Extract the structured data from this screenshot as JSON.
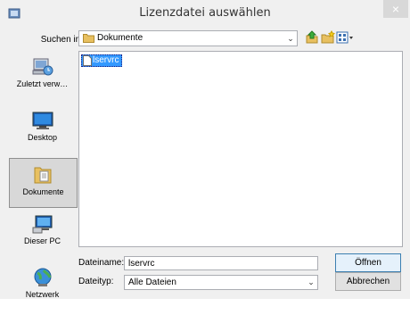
{
  "window": {
    "title": "Lizenzdatei auswählen",
    "close_glyph": "×"
  },
  "lookin": {
    "label": "Suchen in:",
    "value": "Dokumente"
  },
  "places": [
    {
      "label": "Zuletzt verw…",
      "icon": "recent-icon"
    },
    {
      "label": "Desktop",
      "icon": "desktop-icon"
    },
    {
      "label": "Dokumente",
      "icon": "documents-icon",
      "selected": true
    },
    {
      "label": "Dieser PC",
      "icon": "computer-icon"
    },
    {
      "label": "Netzwerk",
      "icon": "network-icon"
    }
  ],
  "files": [
    {
      "name": "lservrc",
      "selected": true
    }
  ],
  "filename": {
    "label": "Dateiname:",
    "value": "lservrc"
  },
  "filetype": {
    "label": "Dateityp:",
    "value": "Alle Dateien"
  },
  "buttons": {
    "open": "Öffnen",
    "cancel": "Abbrechen"
  },
  "colors": {
    "selection": "#3399ff",
    "dialog_bg": "#f0f0f0"
  }
}
